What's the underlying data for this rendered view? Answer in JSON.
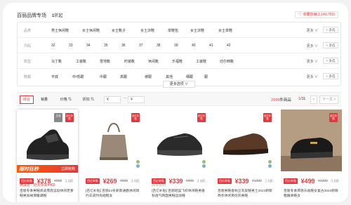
{
  "header": {
    "title": "百丽品牌专场",
    "count_num": "1",
    "count_unit": "折起",
    "fav_label": "♡ 收藏店铺(1,140,750)"
  },
  "filters": [
    {
      "label": "品类",
      "options": [
        "男士休闲鞋",
        "女士休闲鞋",
        "女士靴子",
        "女士凉鞋",
        "单鞋包",
        "女士凉鞋",
        "女士单鞋"
      ],
      "more": "更多 ∨",
      "multi": "+ 多选"
    },
    {
      "label": "尺码",
      "options": [
        "32",
        "33",
        "34",
        "35",
        "36",
        "37",
        "38",
        "39",
        "40",
        "41",
        "42"
      ],
      "more": "更多 ∨",
      "multi": "+ 多选"
    },
    {
      "label": "款型",
      "options": [
        "马丁靴",
        "工装靴",
        "雪地靴",
        "时装靴",
        "休闲靴",
        "乐福鞋",
        "工装鞋",
        "切尔西靴"
      ],
      "more": "更多 ∨",
      "multi": "+ 多选"
    },
    {
      "label": "鞋跟",
      "options": [
        "平底",
        "中/低跟",
        "中跟",
        "高跟",
        "坡跟",
        "其他",
        "细跟",
        "跟"
      ],
      "more": "更多 ∨",
      "multi": "+ 多选"
    }
  ],
  "show_more": "更多选项 ∨",
  "sortbar": {
    "sorts": [
      "综合",
      "销量",
      "价格 ⇅",
      "折扣 ⇅"
    ],
    "price_min": "¥",
    "price_max": "¥",
    "range_dash": "—",
    "result_count": "2109",
    "result_unit": "件商品",
    "page_current": "1",
    "page_total": "/11",
    "prev": "<",
    "next": "下一页 >"
  },
  "products": [
    {
      "price": "¥378",
      "old": "¥998",
      "disc": "3.4折",
      "sub": "满减省 · 抢完恢复¥469",
      "desc": "百丽冬季男鞋真皮厚底运动休闲老爹鞋男加绒保暖潮鞋",
      "badge": "百亿补贴",
      "promo_left": "限时狂秒",
      "promo_right": "立即抢购",
      "tag": "百亿补贴",
      "tag2": "正品"
    },
    {
      "price": "¥269",
      "old": "¥999",
      "disc": "3.4折",
      "sub": "",
      "desc": "[百亿补贴] 百丽24冬新款通勤休闲简约羊皮时尚短靴女",
      "badge": "百亿补贴",
      "tag": "百亿补贴"
    },
    {
      "price": "¥339",
      "old": "¥999",
      "disc": "3.4折",
      "sub": "30天低价",
      "desc": "[百亿补贴] 百丽轻盈飞织休闲鞋男春秋透气网面男鞋运动鞋",
      "badge": "百亿补贴",
      "tag": "百亿补贴"
    },
    {
      "price": "¥339",
      "old": "¥1299",
      "disc": "2.6折",
      "sub": "",
      "desc": "百丽男鞋春秋正装皮鞋男士2024新款商务休闲英伦风男鞋",
      "badge": "百亿补贴",
      "tag": "百亿补贴"
    },
    {
      "price": "¥499",
      "old": "¥1299",
      "disc": "3.8折",
      "sub": "",
      "desc": "百丽冬季厚底乐福鞋女复古2024新款粗跟单鞋女",
      "badge": "百亿补贴",
      "tag": "百亿补贴"
    }
  ],
  "colors": {
    "accent": "#e4393c",
    "promo": "#ff5a00"
  }
}
